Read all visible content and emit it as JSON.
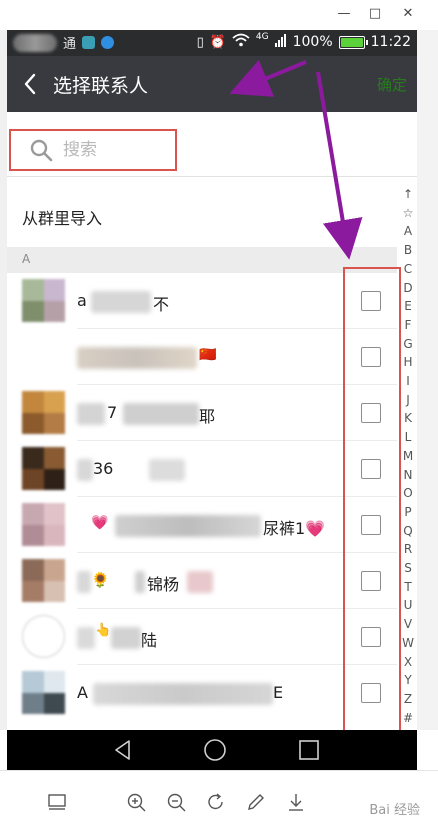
{
  "window": {
    "minimize": "—",
    "maximize": "□",
    "close": "✕"
  },
  "status_bar": {
    "carrier": "通",
    "network": "4G",
    "battery": "100%",
    "battery_level": 1.0,
    "time": "11:22"
  },
  "title_bar": {
    "title": "选择联系人",
    "confirm": "确定"
  },
  "search": {
    "placeholder": "搜索"
  },
  "import_group": {
    "label": "从群里导入"
  },
  "section": {
    "letter": "A"
  },
  "contacts": [
    {
      "visible_text": "a",
      "suffix": "不"
    },
    {
      "visible_text": "",
      "suffix": "🇨🇳"
    },
    {
      "visible_text": "7",
      "suffix": "耶"
    },
    {
      "visible_text": "36",
      "suffix": ""
    },
    {
      "visible_text": "💗",
      "suffix": "尿裤1💗"
    },
    {
      "visible_text": "🌻",
      "suffix": "锦杨"
    },
    {
      "visible_text": "👆",
      "suffix": "陆"
    },
    {
      "visible_text": "A",
      "suffix": "E"
    }
  ],
  "index_letters": [
    "↑",
    "☆",
    "A",
    "B",
    "C",
    "D",
    "E",
    "F",
    "G",
    "H",
    "I",
    "J",
    "K",
    "L",
    "M",
    "N",
    "O",
    "P",
    "Q",
    "R",
    "S",
    "T",
    "U",
    "V",
    "W",
    "X",
    "Y",
    "Z",
    "#"
  ],
  "colors": {
    "title_bar": "#393a3f",
    "confirm_green": "#267c1d",
    "highlight_red": "#d9534f",
    "arrow_purple": "#8b1a9e"
  },
  "toolbar": {
    "watermark": "Bai 经验"
  }
}
